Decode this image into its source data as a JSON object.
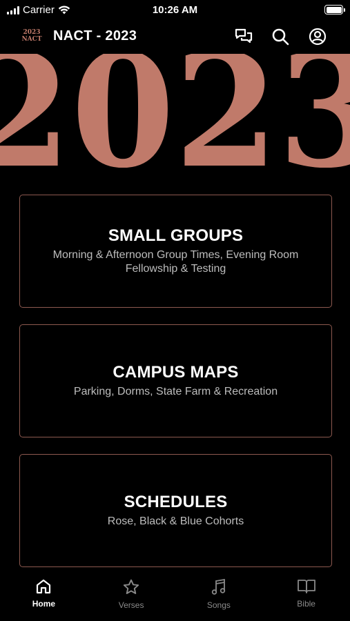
{
  "status_bar": {
    "carrier": "Carrier",
    "time": "10:26 AM"
  },
  "header": {
    "logo_line1": "2023",
    "logo_line2": "NACT",
    "title": "NACT - 2023",
    "icons": [
      "chat-icon",
      "search-icon",
      "profile-icon"
    ]
  },
  "banner": {
    "text": "2023",
    "color": "#c07a6a"
  },
  "cards": [
    {
      "title": "SMALL GROUPS",
      "subtitle": "Morning & Afternoon Group Times, Evening Room Fellowship & Testing"
    },
    {
      "title": "CAMPUS MAPS",
      "subtitle": "Parking, Dorms, State Farm & Recreation"
    },
    {
      "title": "SCHEDULES",
      "subtitle": "Rose, Black & Blue Cohorts"
    }
  ],
  "tabs": [
    {
      "label": "Home",
      "icon": "home-icon",
      "active": true
    },
    {
      "label": "Verses",
      "icon": "star-icon",
      "active": false
    },
    {
      "label": "Songs",
      "icon": "music-note-icon",
      "active": false
    },
    {
      "label": "Bible",
      "icon": "book-icon",
      "active": false
    }
  ],
  "colors": {
    "accent": "#c07a6a",
    "card_border": "#8e5a50",
    "background": "#000000"
  }
}
